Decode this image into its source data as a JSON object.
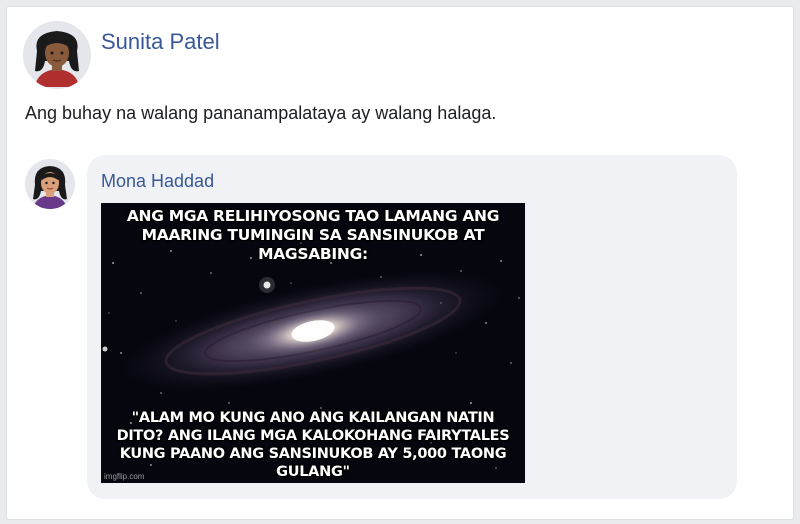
{
  "post": {
    "author": "Sunita Patel",
    "text": "Ang buhay na walang pananampalataya ay walang halaga."
  },
  "comment": {
    "author": "Mona Haddad",
    "meme": {
      "top_text": "ANG MGA RELIHIYOSONG TAO LAMANG ANG\nMAARING TUMINGIN SA SANSINUKOB AT MAGSABING:",
      "bottom_text": "\"ALAM MO KUNG ANO ANG KAILANGAN NATIN\nDITO? ANG ILANG MGA KALOKOHANG FAIRYTALES\nKUNG PAANO ANG SANSINUKOB AY 5,000 TAONG GULANG\"",
      "watermark": "imgflip.com"
    }
  }
}
